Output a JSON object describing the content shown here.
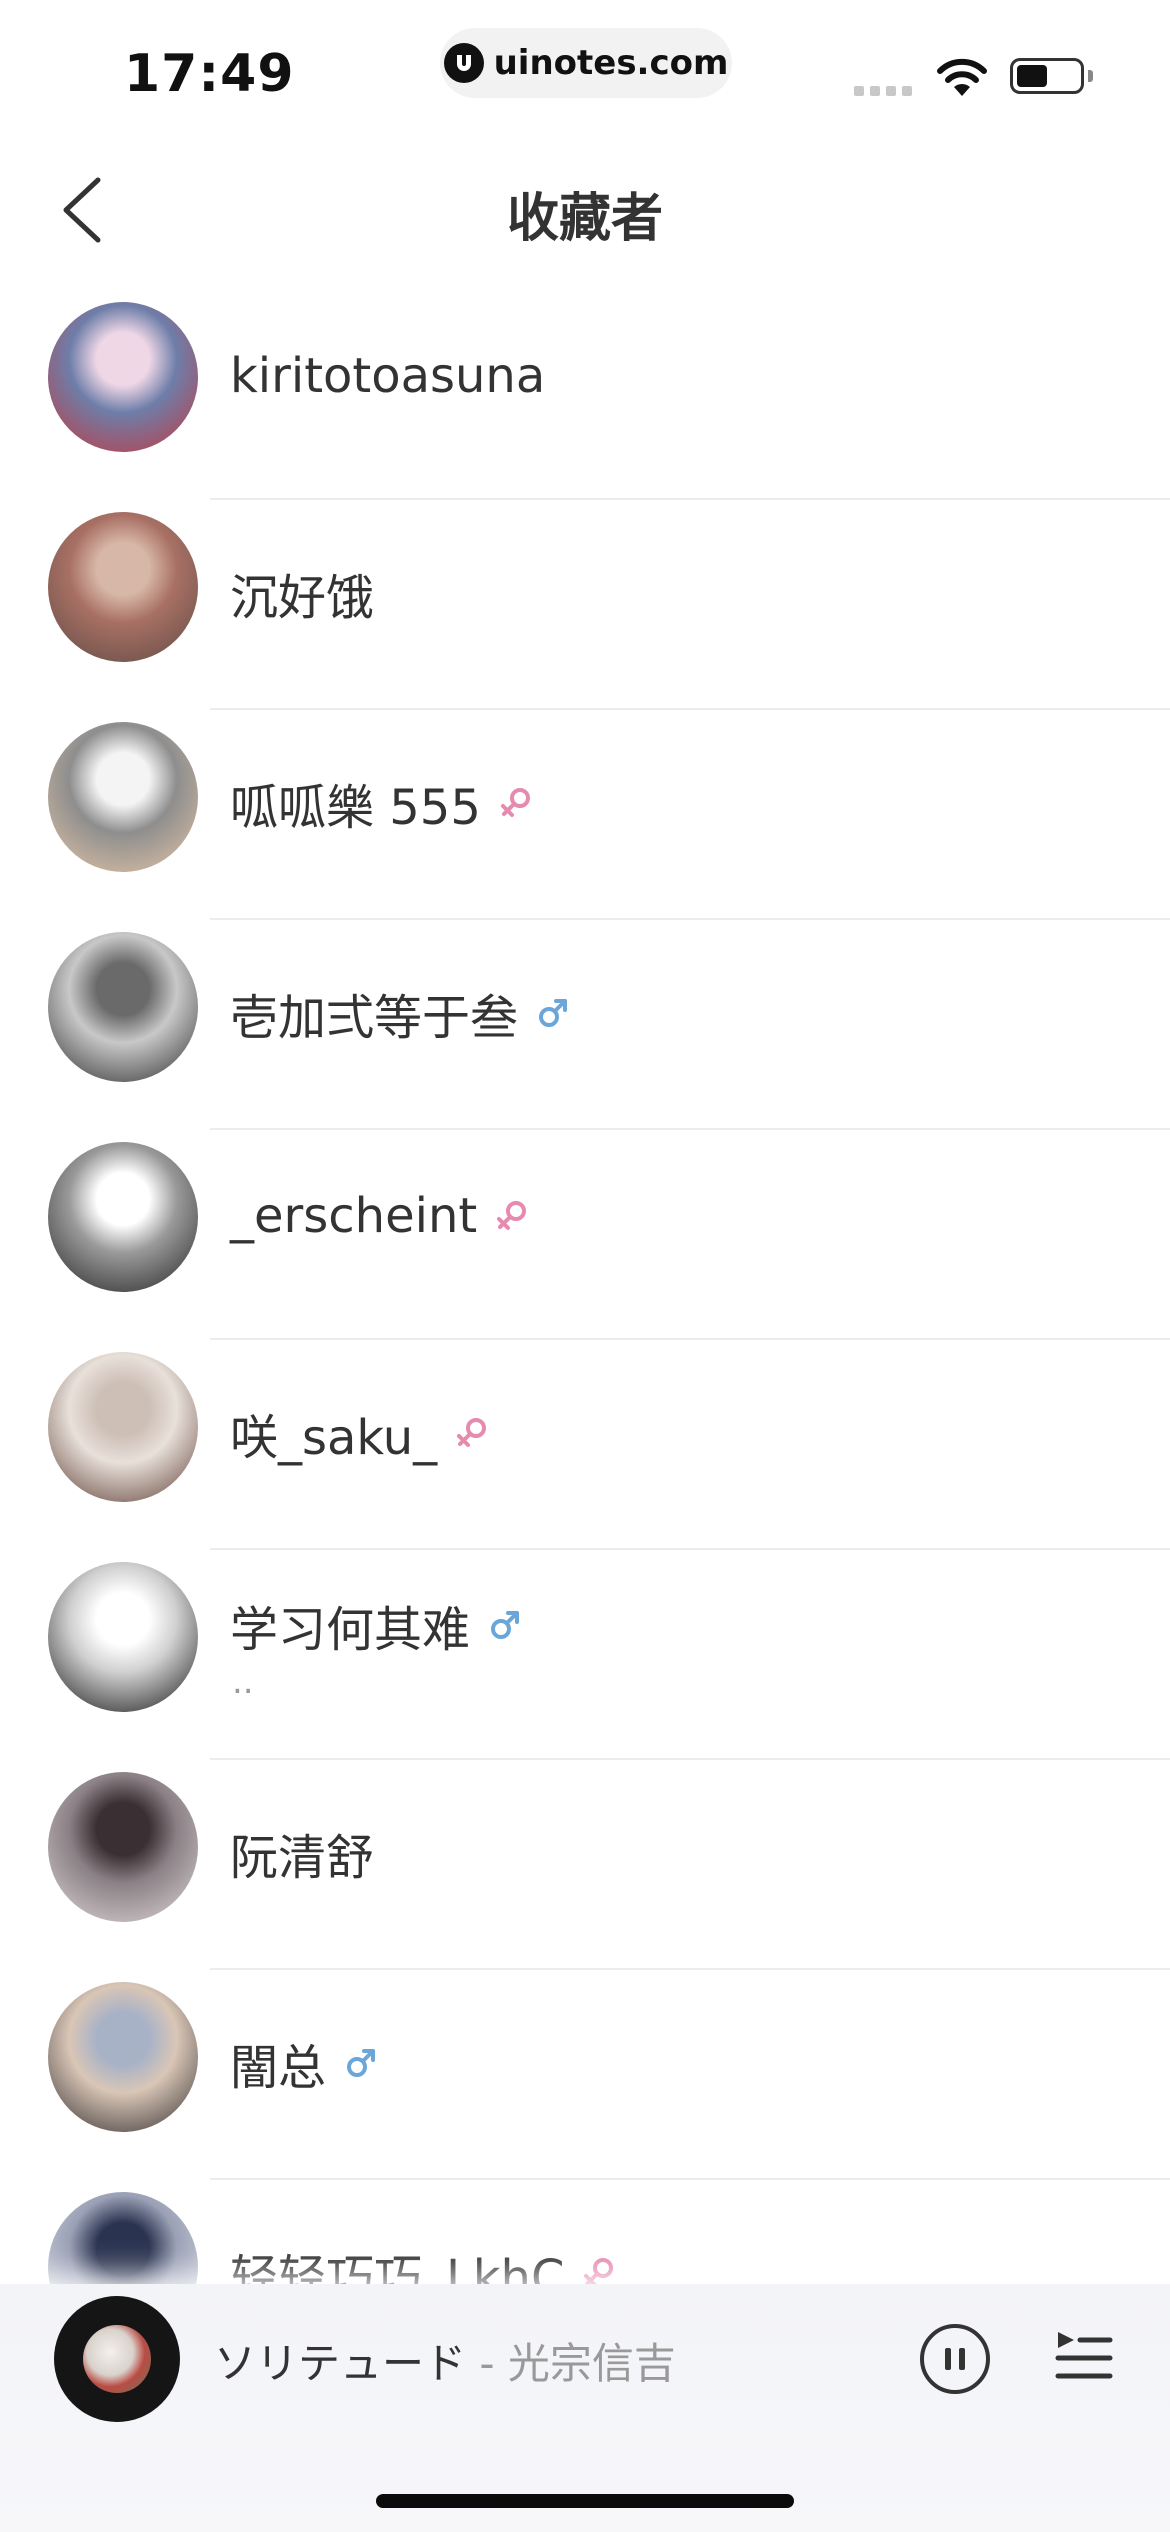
{
  "status_bar": {
    "time": "17:49",
    "url": "uinotes.com"
  },
  "nav": {
    "title": "收藏者"
  },
  "users": [
    {
      "name": "kiritotoasuna",
      "gender": "",
      "signature": "",
      "avatar_colors": [
        "#f0d7e6",
        "#c4373e",
        "#6e7ea9"
      ]
    },
    {
      "name": "沉好饿",
      "gender": "",
      "signature": "",
      "avatar_colors": [
        "#d7b7a7",
        "#5e4a44",
        "#a87064"
      ]
    },
    {
      "name": "呱呱樂 555",
      "gender": "female",
      "signature": "",
      "avatar_colors": [
        "#f4f4f4",
        "#e6c6a6",
        "#8e8e8e"
      ]
    },
    {
      "name": "壱加弍等于叁",
      "gender": "male",
      "signature": "",
      "avatar_colors": [
        "#6a6a6a",
        "#2a2a2a",
        "#c8c8c8"
      ]
    },
    {
      "name": "_erscheint",
      "gender": "female",
      "signature": "",
      "avatar_colors": [
        "#ffffff",
        "#222222",
        "#9a9a9a"
      ]
    },
    {
      "name": "咲_saku_",
      "gender": "female",
      "signature": "",
      "avatar_colors": [
        "#cdbfb6",
        "#5a3b30",
        "#e8e0da"
      ]
    },
    {
      "name": "学习何其难",
      "gender": "male",
      "signature": "..",
      "avatar_colors": [
        "#ffffff",
        "#111111",
        "#cfcfcf"
      ]
    },
    {
      "name": "阮清舒",
      "gender": "",
      "signature": "",
      "avatar_colors": [
        "#3a3033",
        "#e0d8d8",
        "#8a8085"
      ]
    },
    {
      "name": "闇总",
      "gender": "male",
      "signature": "",
      "avatar_colors": [
        "#a8b2c7",
        "#2e2a2c",
        "#d9c6b6"
      ]
    },
    {
      "name": "轻轻巧巧_LkhC",
      "gender": "female",
      "signature": "",
      "avatar_colors": [
        "#2a3350",
        "#e6e8f0",
        "#9aa0b5"
      ]
    }
  ],
  "player": {
    "title": "ソリテュード",
    "artist": " - 光宗信吉"
  },
  "colors": {
    "female": "#e68ab0",
    "male": "#6aa7d8"
  }
}
